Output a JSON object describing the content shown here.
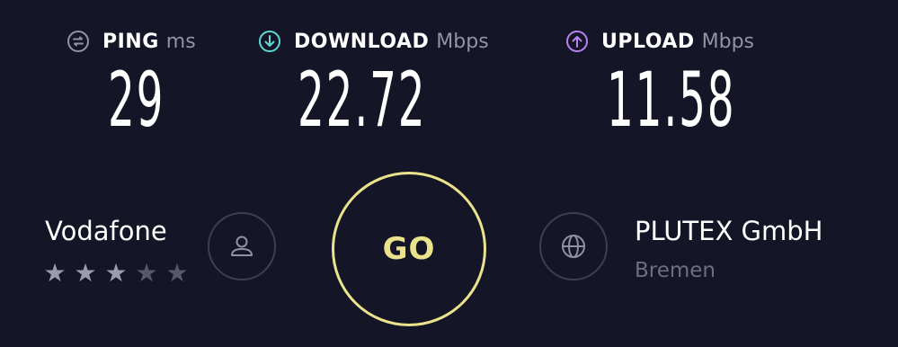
{
  "metrics": {
    "ping": {
      "label": "PING",
      "unit": "ms",
      "value": "29",
      "icon": "ping-icon"
    },
    "download": {
      "label": "DOWNLOAD",
      "unit": "Mbps",
      "value": "22.72",
      "icon": "download-arrow-icon"
    },
    "upload": {
      "label": "UPLOAD",
      "unit": "Mbps",
      "value": "11.58",
      "icon": "upload-arrow-icon"
    }
  },
  "isp": {
    "name": "Vodafone",
    "rating": 3,
    "rating_max": 5
  },
  "go_button": {
    "label": "GO"
  },
  "server": {
    "name": "PLUTEX GmbH",
    "location": "Bremen"
  },
  "colors": {
    "background": "#141526",
    "go_accent": "#eae38c",
    "download_accent": "#5fd9d4",
    "upload_accent": "#b982f0",
    "muted": "#9193a8"
  }
}
